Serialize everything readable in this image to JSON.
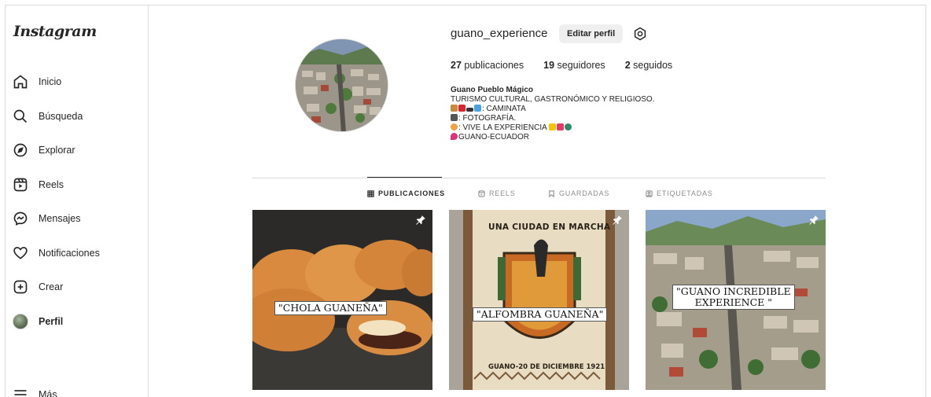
{
  "sidebar": {
    "logo": "Instagram",
    "items": [
      {
        "label": "Inicio",
        "icon": "home-icon"
      },
      {
        "label": "Búsqueda",
        "icon": "search-icon"
      },
      {
        "label": "Explorar",
        "icon": "compass-icon"
      },
      {
        "label": "Reels",
        "icon": "reels-icon"
      },
      {
        "label": "Mensajes",
        "icon": "messenger-icon"
      },
      {
        "label": "Notificaciones",
        "icon": "heart-icon"
      },
      {
        "label": "Crear",
        "icon": "plus-square-icon"
      },
      {
        "label": "Perfil",
        "icon": "avatar"
      }
    ],
    "more": "Más"
  },
  "profile": {
    "username": "guano_experience",
    "edit_label": "Editar perfil",
    "stats": [
      {
        "count": "27",
        "label": "publicaciones"
      },
      {
        "count": "19",
        "label": "seguidores"
      },
      {
        "count": "2",
        "label": "seguidos"
      }
    ],
    "bio": {
      "name": "Guano Pueblo Mágico",
      "line1": "TURISMO CULTURAL, GASTRONÓMICO Y RELIGIOSO.",
      "line2": ": CAMINATA",
      "line3": ": FOTOGRAFÍA.",
      "line4": ": VIVE LA EXPERIENCIA",
      "line5": "GUANO-ECUADOR"
    }
  },
  "tabs": [
    {
      "label": "PUBLICACIONES",
      "icon": "grid-icon",
      "active": true
    },
    {
      "label": "REELS",
      "icon": "reels-tab-icon",
      "active": false
    },
    {
      "label": "GUARDADAS",
      "icon": "bookmark-icon",
      "active": false
    },
    {
      "label": "ETIQUETADAS",
      "icon": "tagged-icon",
      "active": false
    }
  ],
  "posts": [
    {
      "caption": "\"CHOLA GUANEÑA\"",
      "pinned": true
    },
    {
      "caption": "\"ALFOMBRA GUANEÑA\"",
      "banner_top": "UNA CIUDAD EN MARCHA",
      "banner_bottom": "GUANO-20 DE DICIEMBRE 1921",
      "pinned": true
    },
    {
      "caption_line1": "\"GUANO INCREDIBLE",
      "caption_line2": "EXPERIENCE \"",
      "pinned": true
    }
  ],
  "colors": {
    "text": "#262626",
    "muted": "#8e8e8e",
    "border": "#dbdbdb",
    "button_bg": "#efefef"
  }
}
